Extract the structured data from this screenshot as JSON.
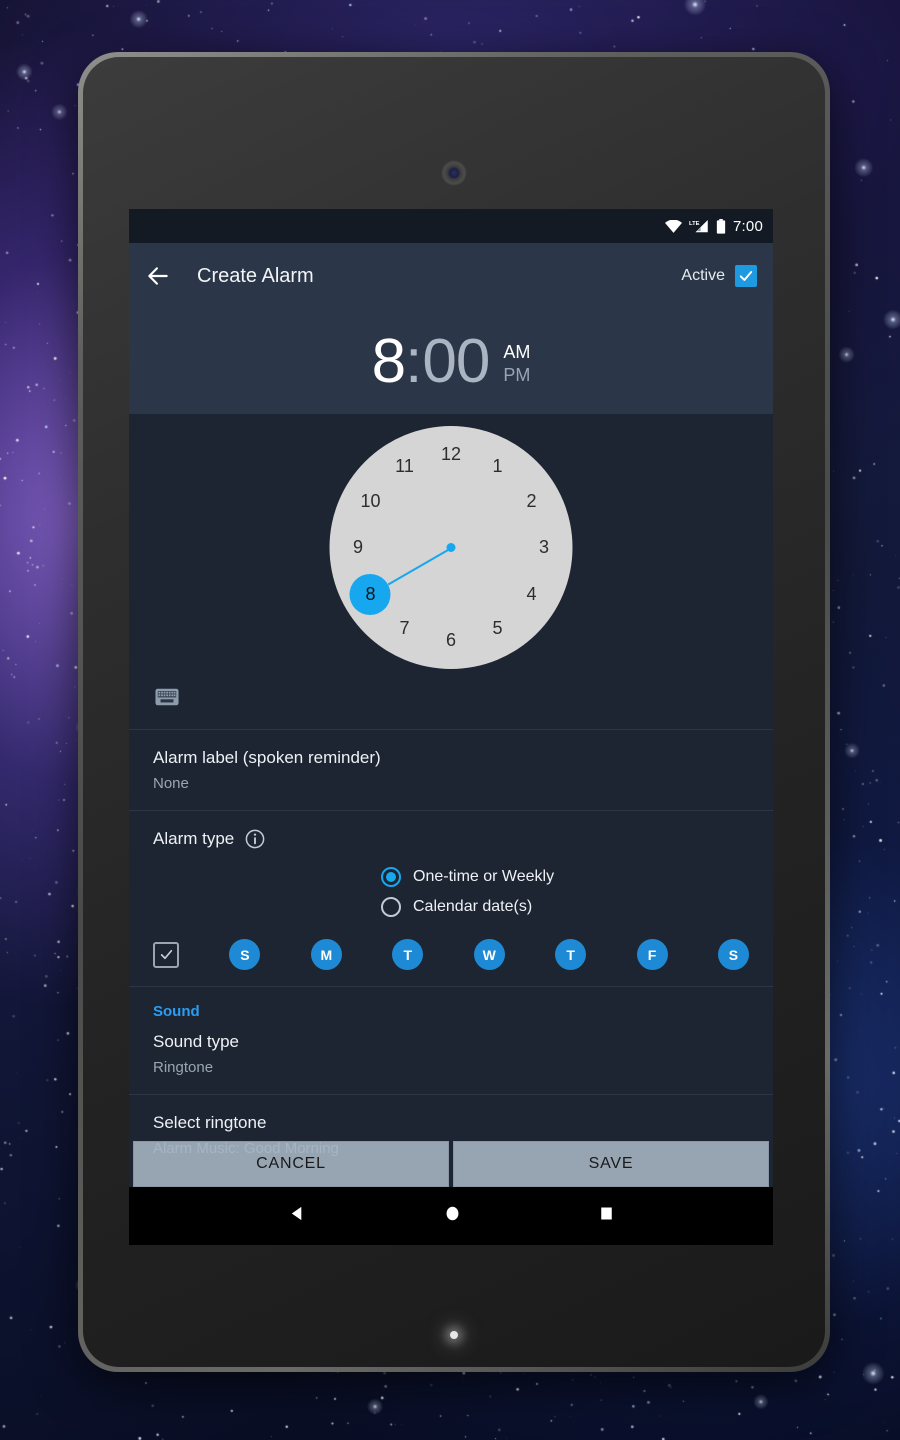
{
  "status_bar": {
    "time": "7:00",
    "icons": [
      "wifi-icon",
      "lte-signal-icon",
      "battery-icon"
    ],
    "lte_label": "LTE"
  },
  "appbar": {
    "back_icon": "back-arrow-icon",
    "title": "Create Alarm",
    "active_label": "Active",
    "active_checked": true
  },
  "time_display": {
    "hour": "8",
    "separator": ":",
    "minute": "00",
    "am": "AM",
    "pm": "PM",
    "selected_meridiem": "AM",
    "selected_field": "hour"
  },
  "clock_picker": {
    "numbers": [
      "12",
      "1",
      "2",
      "3",
      "4",
      "5",
      "6",
      "7",
      "8",
      "9",
      "10",
      "11"
    ],
    "selected": "8",
    "keyboard_icon": "keyboard-icon"
  },
  "alarm_label": {
    "title": "Alarm label (spoken reminder)",
    "value": "None"
  },
  "alarm_type": {
    "title": "Alarm type",
    "info_icon": "info-icon",
    "options": [
      {
        "label": "One-time or Weekly",
        "selected": true
      },
      {
        "label": "Calendar date(s)",
        "selected": false
      }
    ]
  },
  "days": {
    "all_checkbox_checked": true,
    "items": [
      {
        "label": "S",
        "selected": true
      },
      {
        "label": "M",
        "selected": true
      },
      {
        "label": "T",
        "selected": true
      },
      {
        "label": "W",
        "selected": true
      },
      {
        "label": "T",
        "selected": true
      },
      {
        "label": "F",
        "selected": true
      },
      {
        "label": "S",
        "selected": true
      }
    ]
  },
  "sound": {
    "section_title": "Sound",
    "sound_type_title": "Sound type",
    "sound_type_value": "Ringtone",
    "select_ringtone_title": "Select ringtone",
    "select_ringtone_value": "Alarm Music: Good Morning"
  },
  "footer": {
    "cancel_label": "CANCEL",
    "save_label": "SAVE"
  },
  "nav_bar": {
    "back": "nav-back-triangle-icon",
    "home": "nav-home-circle-icon",
    "recents": "nav-recents-square-icon"
  },
  "colors": {
    "accent": "#17a7ee",
    "appbar": "#2b3749",
    "background": "#1c2531",
    "section_header": "#2a9df4",
    "day_pill": "#1e8ad6"
  }
}
